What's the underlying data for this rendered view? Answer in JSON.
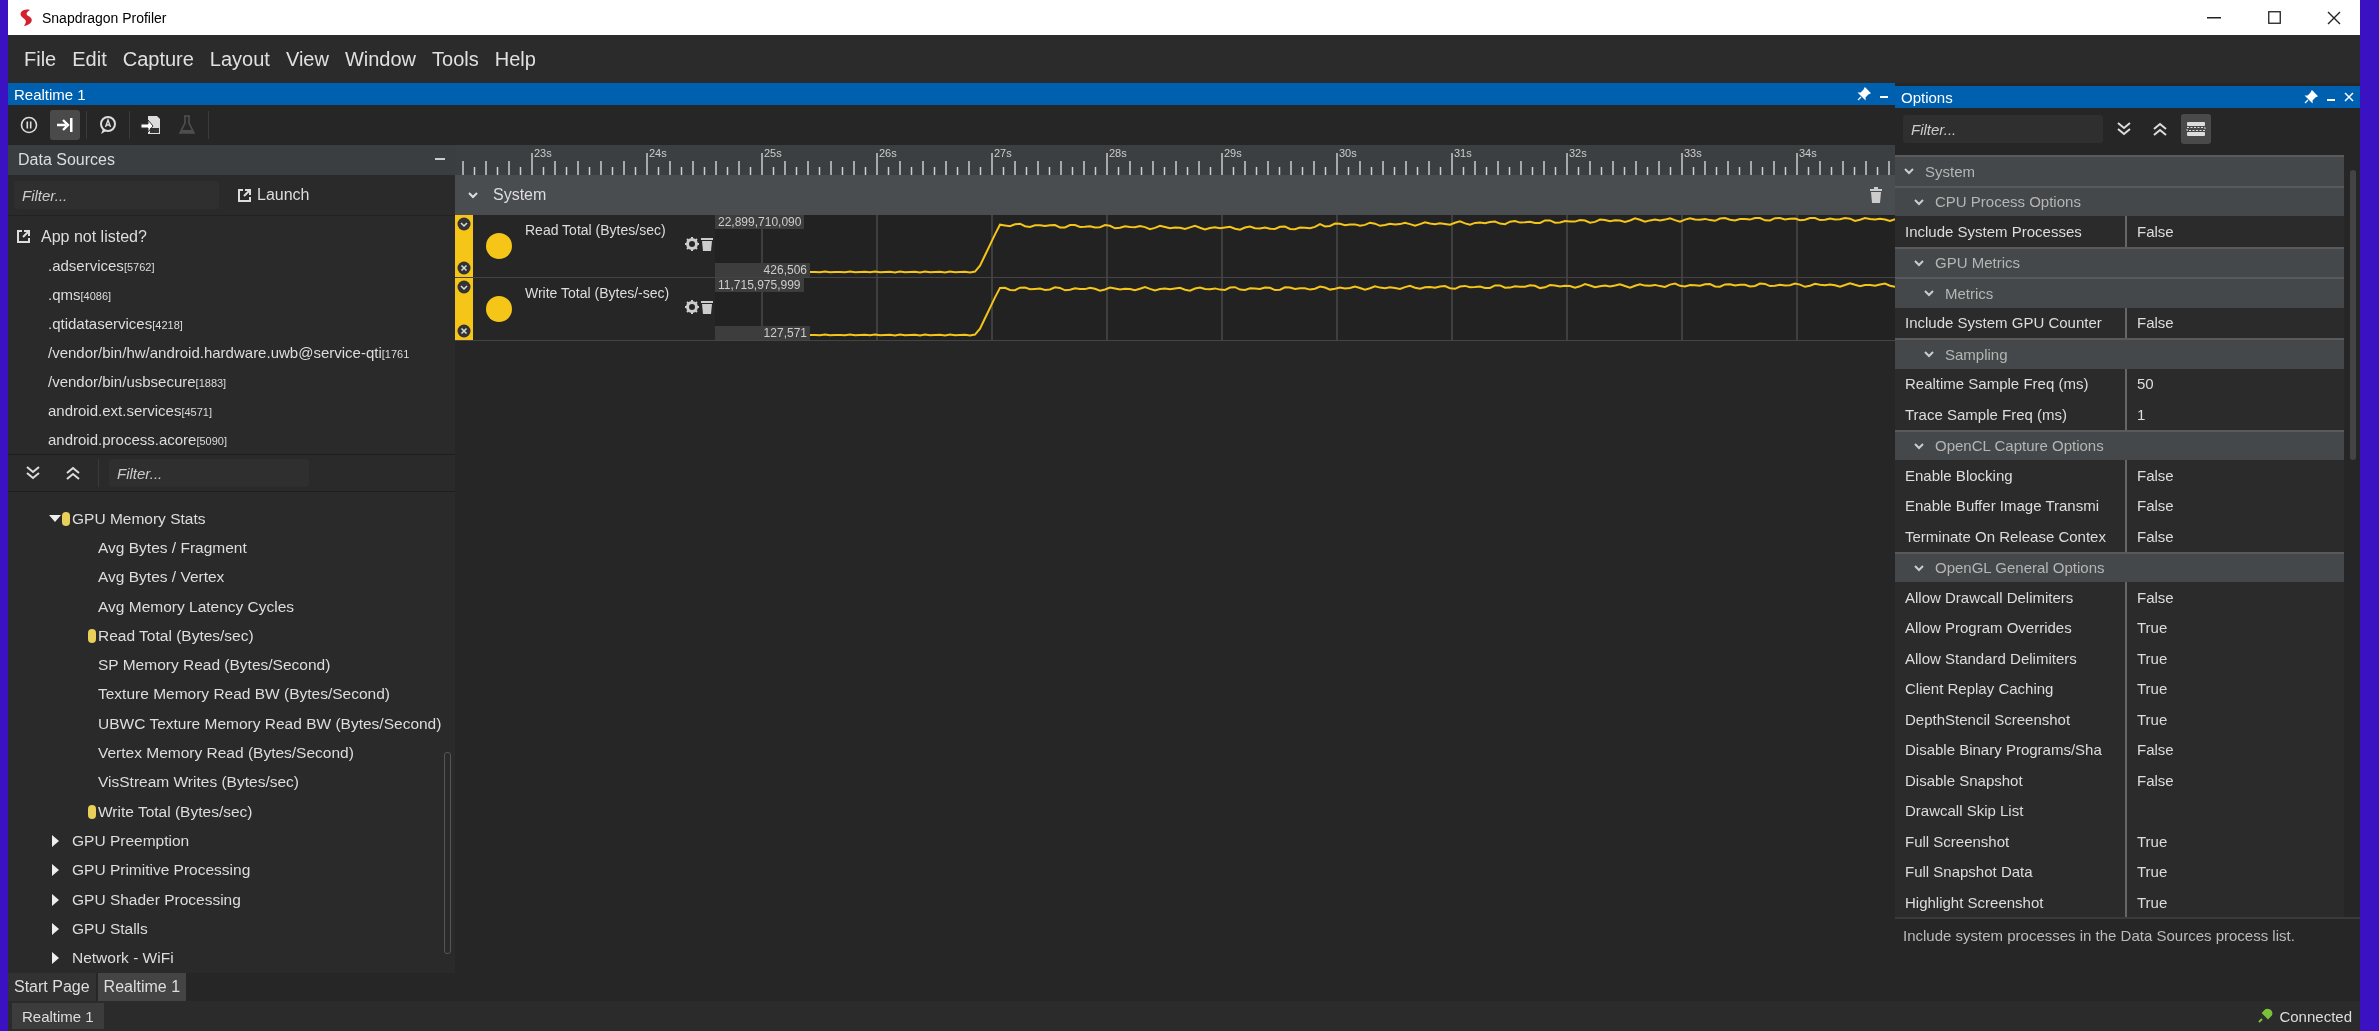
{
  "window": {
    "title": "Snapdragon Profiler"
  },
  "menu": [
    "File",
    "Edit",
    "Capture",
    "Layout",
    "View",
    "Window",
    "Tools",
    "Help"
  ],
  "realtime_panel": {
    "title": "Realtime 1",
    "toolbar": [
      {
        "kind": "pause",
        "toggled": false,
        "disabled": false
      },
      {
        "kind": "follow",
        "toggled": true,
        "disabled": false
      },
      {
        "kind": "annotate",
        "toggled": false,
        "disabled": false
      },
      {
        "kind": "export",
        "toggled": false,
        "disabled": false
      },
      {
        "kind": "flask",
        "toggled": false,
        "disabled": true
      }
    ]
  },
  "data_sources": {
    "title": "Data Sources",
    "filter_placeholder": "Filter...",
    "launch_label": "Launch",
    "app_not_listed": "App not listed?",
    "processes": [
      {
        "name": ".adservices",
        "pid": "[5762]"
      },
      {
        "name": ".qms",
        "pid": "[4086]"
      },
      {
        "name": ".qtidataservices",
        "pid": "[4218]"
      },
      {
        "name": "/vendor/bin/hw/android.hardware.uwb@service-qti",
        "pid": "[1761"
      },
      {
        "name": "/vendor/bin/usbsecure",
        "pid": "[1883]"
      },
      {
        "name": "android.ext.services",
        "pid": "[4571]"
      },
      {
        "name": "android.process.acore",
        "pid": "[5090]"
      }
    ]
  },
  "metrics_tree": {
    "filter_placeholder": "Filter...",
    "items": [
      {
        "label": "GPU Memory Stats",
        "expanded": true,
        "tracked": true,
        "children": [
          {
            "label": "Avg Bytes / Fragment",
            "tracked": false
          },
          {
            "label": "Avg Bytes / Vertex",
            "tracked": false
          },
          {
            "label": "Avg Memory Latency Cycles",
            "tracked": false
          },
          {
            "label": "Read Total (Bytes/sec)",
            "tracked": true
          },
          {
            "label": "SP Memory Read (Bytes/Second)",
            "tracked": false
          },
          {
            "label": "Texture Memory Read BW (Bytes/Second)",
            "tracked": false
          },
          {
            "label": "UBWC Texture Memory Read BW (Bytes/Second)",
            "tracked": false
          },
          {
            "label": "Vertex Memory Read (Bytes/Second)",
            "tracked": false
          },
          {
            "label": "VisStream Writes (Bytes/sec)",
            "tracked": false
          },
          {
            "label": "Write Total (Bytes/sec)",
            "tracked": true
          }
        ]
      },
      {
        "label": "GPU Preemption",
        "expanded": false,
        "tracked": false
      },
      {
        "label": "GPU Primitive Processing",
        "expanded": false,
        "tracked": false
      },
      {
        "label": "GPU Shader Processing",
        "expanded": false,
        "tracked": false
      },
      {
        "label": "GPU Stalls",
        "expanded": false,
        "tracked": false
      },
      {
        "label": "Network - WiFi",
        "expanded": false,
        "tracked": false
      }
    ]
  },
  "doc_tabs": [
    {
      "label": "Start Page",
      "selected": false
    },
    {
      "label": "Realtime 1",
      "selected": true
    }
  ],
  "timeline": {
    "ticks": [
      "23s",
      "24s",
      "25s",
      "26s",
      "27s",
      "28s",
      "29s",
      "30s",
      "31s",
      "32s",
      "33s",
      "34s"
    ],
    "group": {
      "label": "System",
      "expanded": true
    },
    "tracks": [
      {
        "name": "Read Total (Bytes/sec)",
        "max": "22,899,710,090",
        "min": "426,506",
        "color": "#f5c518"
      },
      {
        "name": "Write Total (Bytes/-sec)",
        "max": "11,715,975,999",
        "min": "127,571",
        "color": "#f5c518"
      }
    ]
  },
  "options": {
    "title": "Options",
    "filter_placeholder": "Filter...",
    "toolbar": [
      {
        "kind": "expand-all",
        "toggled": false
      },
      {
        "kind": "collapse-all",
        "toggled": false
      },
      {
        "kind": "categorize",
        "toggled": true
      }
    ],
    "tree": [
      {
        "kind": "category",
        "label": "System",
        "expanded": true,
        "children": [
          {
            "kind": "category",
            "label": "CPU Process Options",
            "expanded": true,
            "children": [
              {
                "kind": "property",
                "name": "Include System Processes",
                "value": "False"
              }
            ]
          },
          {
            "kind": "category",
            "label": "GPU Metrics",
            "expanded": true,
            "children": [
              {
                "kind": "category",
                "label": "Metrics",
                "expanded": true,
                "children": [
                  {
                    "kind": "property",
                    "name": "Include System GPU Counter",
                    "value": "False"
                  }
                ]
              },
              {
                "kind": "category",
                "label": "Sampling",
                "expanded": true,
                "children": [
                  {
                    "kind": "property",
                    "name": "Realtime Sample Freq (ms)",
                    "value": "50"
                  },
                  {
                    "kind": "property",
                    "name": "Trace Sample Freq (ms)",
                    "value": "1"
                  }
                ]
              }
            ]
          },
          {
            "kind": "category",
            "label": "OpenCL Capture Options",
            "expanded": true,
            "children": [
              {
                "kind": "property",
                "name": "Enable Blocking",
                "value": "False"
              },
              {
                "kind": "property",
                "name": "Enable Buffer Image Transmi",
                "value": "False"
              },
              {
                "kind": "property",
                "name": "Terminate On Release Contex",
                "value": "False"
              }
            ]
          },
          {
            "kind": "category",
            "label": "OpenGL General Options",
            "expanded": true,
            "children": [
              {
                "kind": "property",
                "name": "Allow Drawcall Delimiters",
                "value": "False"
              },
              {
                "kind": "property",
                "name": "Allow Program Overrides",
                "value": "True"
              },
              {
                "kind": "property",
                "name": "Allow Standard Delimiters",
                "value": "True"
              },
              {
                "kind": "property",
                "name": "Client Replay Caching",
                "value": "True"
              },
              {
                "kind": "property",
                "name": "DepthStencil Screenshot",
                "value": "True"
              },
              {
                "kind": "property",
                "name": "Disable Binary Programs/Sha",
                "value": "False"
              },
              {
                "kind": "property",
                "name": "Disable Snapshot",
                "value": "False"
              },
              {
                "kind": "property",
                "name": "Drawcall Skip List"
              },
              {
                "kind": "property",
                "name": "Full Screenshot",
                "value": "True"
              },
              {
                "kind": "property",
                "name": "Full Snapshot Data",
                "value": "True"
              },
              {
                "kind": "property",
                "name": "Highlight Screenshot",
                "value": "True"
              }
            ]
          }
        ]
      }
    ],
    "description": "Include system processes in the Data Sources process list."
  },
  "status_bar": {
    "tab": "Realtime 1",
    "connection": "Connected"
  }
}
